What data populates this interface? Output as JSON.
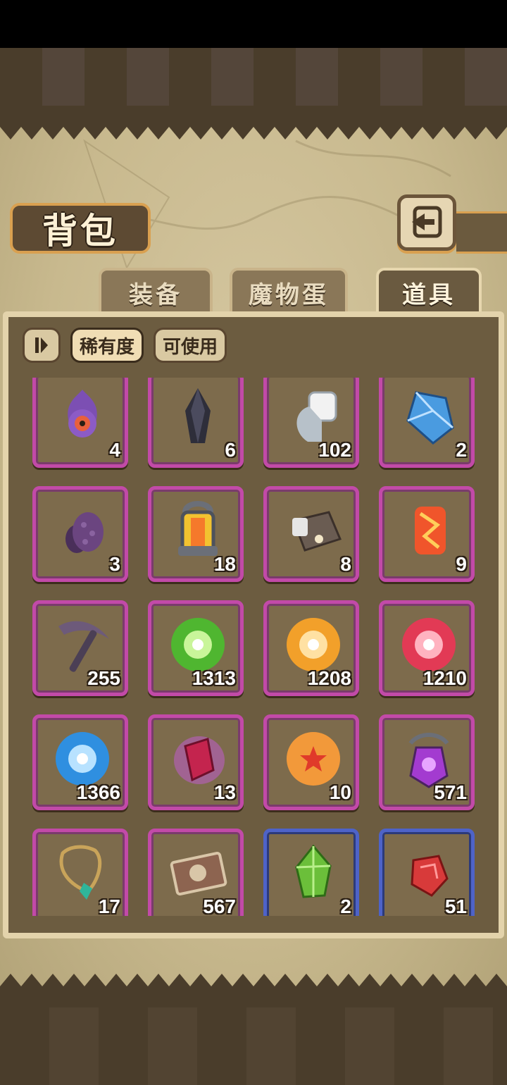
{
  "header": {
    "title": "背包"
  },
  "tabs": [
    {
      "label": "装备",
      "active": false
    },
    {
      "label": "魔物蛋",
      "active": false
    },
    {
      "label": "道具",
      "active": true
    }
  ],
  "filters": {
    "rarity_label": "稀有度",
    "usable_label": "可使用"
  },
  "items": [
    {
      "icon": "tentacle-eye-icon",
      "qty": "4",
      "rarity": "purple"
    },
    {
      "icon": "dark-crystal-icon",
      "qty": "6",
      "rarity": "purple"
    },
    {
      "icon": "scroll-roll-icon",
      "qty": "102",
      "rarity": "purple"
    },
    {
      "icon": "blue-gem-icon",
      "qty": "2",
      "rarity": "purple"
    },
    {
      "icon": "dark-egg-icon",
      "qty": "3",
      "rarity": "purple"
    },
    {
      "icon": "lantern-icon",
      "qty": "18",
      "rarity": "purple"
    },
    {
      "icon": "metal-part-icon",
      "qty": "8",
      "rarity": "purple"
    },
    {
      "icon": "fire-stone-icon",
      "qty": "9",
      "rarity": "purple"
    },
    {
      "icon": "pickaxe-icon",
      "qty": "255",
      "rarity": "purple"
    },
    {
      "icon": "green-orb-icon",
      "qty": "1313",
      "rarity": "purple"
    },
    {
      "icon": "orange-orb-icon",
      "qty": "1208",
      "rarity": "purple"
    },
    {
      "icon": "red-orb-icon",
      "qty": "1210",
      "rarity": "purple"
    },
    {
      "icon": "blue-orb-icon",
      "qty": "1366",
      "rarity": "purple"
    },
    {
      "icon": "magic-crystal-icon",
      "qty": "13",
      "rarity": "purple"
    },
    {
      "icon": "star-orb-icon",
      "qty": "10",
      "rarity": "purple"
    },
    {
      "icon": "purple-potion-icon",
      "qty": "571",
      "rarity": "purple"
    },
    {
      "icon": "necklace-icon",
      "qty": "17",
      "rarity": "purple"
    },
    {
      "icon": "ticket-icon",
      "qty": "567",
      "rarity": "purple"
    },
    {
      "icon": "green-crystal-icon",
      "qty": "2",
      "rarity": "blue"
    },
    {
      "icon": "red-ore-icon",
      "qty": "51",
      "rarity": "blue"
    }
  ]
}
